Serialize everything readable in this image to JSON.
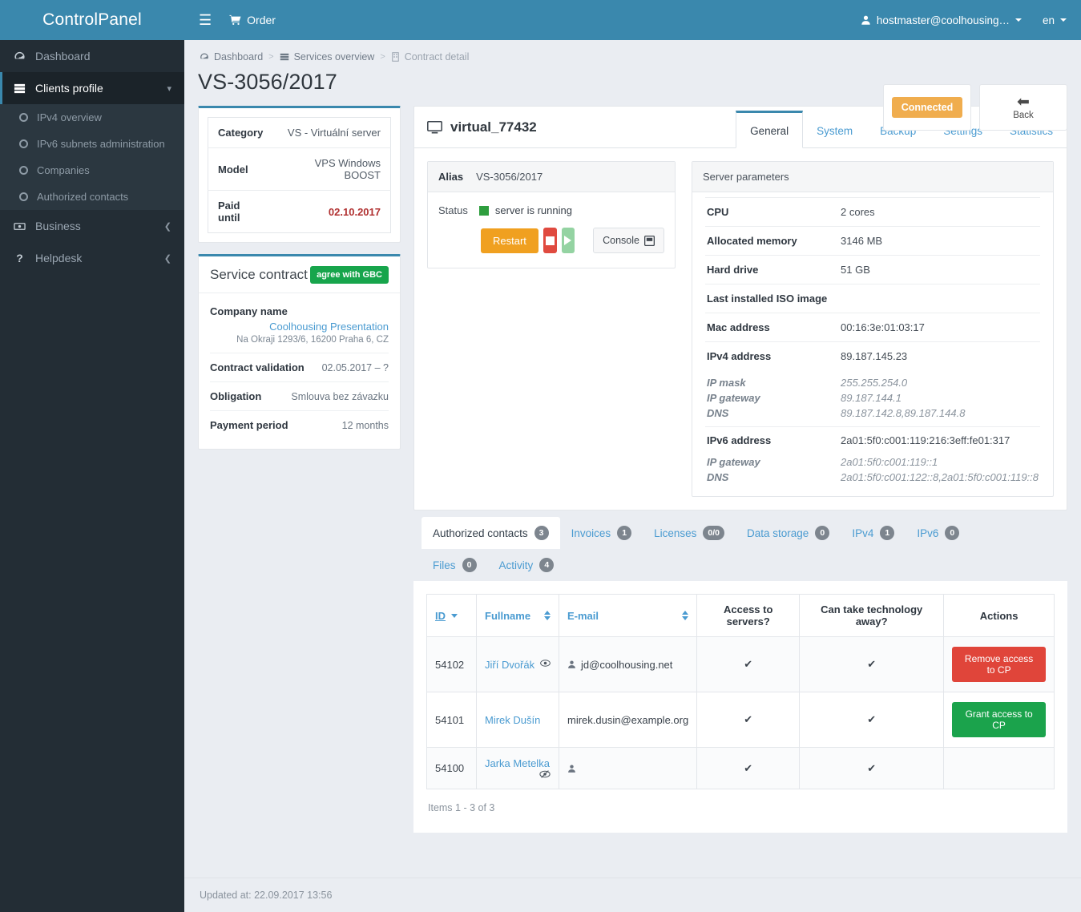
{
  "brand": {
    "title": "ControlPanel"
  },
  "sidebar": {
    "items": [
      {
        "label": "Dashboard",
        "icon": "dashboard-icon",
        "active": false
      },
      {
        "label": "Clients profile",
        "icon": "server-stack-icon",
        "active": true,
        "chevron": "chevron-down-icon"
      },
      {
        "label": "Business",
        "icon": "money-icon",
        "active": false,
        "chevron": "chevron-left-icon"
      },
      {
        "label": "Helpdesk",
        "icon": "question-icon",
        "active": false,
        "chevron": "chevron-left-icon"
      }
    ],
    "subitems": [
      {
        "label": "IPv4 overview"
      },
      {
        "label": "IPv6 subnets administration"
      },
      {
        "label": "Companies"
      },
      {
        "label": "Authorized contacts"
      }
    ]
  },
  "topbar": {
    "menu_icon": "hamburger-icon",
    "order_label": "Order",
    "user_label": "hostmaster@coolhousing…",
    "lang_label": "en"
  },
  "breadcrumb": [
    {
      "label": "Dashboard",
      "icon": "dashboard-icon"
    },
    {
      "label": "Services overview",
      "icon": "server-stack-icon"
    },
    {
      "label": "Contract detail",
      "icon": "building-icon"
    }
  ],
  "page": {
    "title": "VS-3056/2017"
  },
  "head_actions": {
    "connected_label": "Connected",
    "back_label": "Back"
  },
  "summary": {
    "rows": [
      {
        "key": "Category",
        "value": "VS - Virtuální server",
        "red": false
      },
      {
        "key": "Model",
        "value": "VPS Windows BOOST",
        "red": false
      },
      {
        "key": "Paid until",
        "value": "02.10.2017",
        "red": true
      }
    ]
  },
  "service_contract": {
    "title": "Service contract",
    "gbc_badge": "agree with GBC",
    "company_label": "Company name",
    "company_name": "Coolhousing Presentation",
    "company_address": "Na Okraji 1293/6, 16200 Praha 6, CZ",
    "rows": [
      {
        "key": "Contract validation",
        "value": "02.05.2017 – ?"
      },
      {
        "key": "Obligation",
        "value": "Smlouva bez závazku"
      },
      {
        "key": "Payment period",
        "value": "12 months"
      }
    ]
  },
  "server_panel": {
    "name": "virtual_77432",
    "name_icon": "monitor-icon",
    "tabs": [
      {
        "label": "General",
        "active": true
      },
      {
        "label": "System",
        "active": false
      },
      {
        "label": "Backup",
        "active": false
      },
      {
        "label": "Settings",
        "active": false
      },
      {
        "label": "Statistics",
        "active": false
      }
    ],
    "alias_label": "Alias",
    "alias_value": "VS-3056/2017",
    "status_label": "Status",
    "status_value": "server is running",
    "status_color": "#2e9e3e",
    "buttons": {
      "restart": "Restart",
      "stop_icon": "stop-icon",
      "play_icon": "play-icon",
      "console": "Console",
      "console_icon": "terminal-icon"
    },
    "params_title": "Server parameters",
    "params": [
      {
        "key": "CPU",
        "value": "2 cores"
      },
      {
        "key": "Allocated memory",
        "value": "3146 MB"
      },
      {
        "key": "Hard drive",
        "value": "51 GB"
      },
      {
        "key": "Last installed ISO image",
        "value": ""
      },
      {
        "key": "Mac address",
        "value": "00:16:3e:01:03:17"
      },
      {
        "key": "IPv4 address",
        "value": "89.187.145.23"
      }
    ],
    "ipv4_sub": [
      {
        "key": "IP mask",
        "value": "255.255.254.0"
      },
      {
        "key": "IP gateway",
        "value": "89.187.144.1"
      },
      {
        "key": "DNS",
        "value": "89.187.142.8,89.187.144.8"
      }
    ],
    "ipv6": {
      "key": "IPv6 address",
      "value": "2a01:5f0:c001:119:216:3eff:fe01:317"
    },
    "ipv6_sub": [
      {
        "key": "IP gateway",
        "value": "2a01:5f0:c001:119::1"
      },
      {
        "key": "DNS",
        "value": "2a01:5f0:c001:122::8,2a01:5f0:c001:119::8"
      }
    ]
  },
  "bottom_tabs": [
    {
      "label": "Authorized contacts",
      "count": "3",
      "active": true
    },
    {
      "label": "Invoices",
      "count": "1",
      "active": false
    },
    {
      "label": "Licenses",
      "count": "0/0",
      "active": false
    },
    {
      "label": "Data storage",
      "count": "0",
      "active": false
    },
    {
      "label": "IPv4",
      "count": "1",
      "active": false
    },
    {
      "label": "IPv6",
      "count": "0",
      "active": false
    },
    {
      "label": "Files",
      "count": "0",
      "active": false
    },
    {
      "label": "Activity",
      "count": "4",
      "active": false
    }
  ],
  "contacts_table": {
    "headers": {
      "id": "ID",
      "fullname": "Fullname",
      "email": "E-mail",
      "access": "Access to servers?",
      "access_l1": "Access to",
      "access_l2": "servers?",
      "tech_l1": "Can take technology",
      "tech_l2": "away?",
      "actions": "Actions"
    },
    "rows": [
      {
        "id": "54102",
        "fullname": "Jiří Dvořák",
        "vis_icon": "eye-icon",
        "email": "jd@coolhousing.net",
        "email_icon": "user-icon",
        "access": "✔",
        "tech": "✔",
        "action_label": "Remove access to CP",
        "action_type": "remove"
      },
      {
        "id": "54101",
        "fullname": "Mirek Dušín",
        "vis_icon": "",
        "email": "mirek.dusin@example.org",
        "email_icon": "",
        "access": "✔",
        "tech": "✔",
        "action_label": "Grant access to CP",
        "action_type": "grant"
      },
      {
        "id": "54100",
        "fullname": "Jarka Metelka",
        "vis_icon": "eye-slash-icon",
        "email": "",
        "email_icon": "user-icon",
        "access": "✔",
        "tech": "✔",
        "action_label": "",
        "action_type": "none"
      }
    ],
    "items_note": "Items 1 - 3 of 3"
  },
  "footer": {
    "updated": "Updated at: 22.09.2017 13:56"
  },
  "colors": {
    "brand_blue": "#3a88ad",
    "sidebar_dark": "#232d35",
    "link_blue": "#4a9bd1",
    "orange": "#f0a020",
    "green": "#1ba34c",
    "red": "#e0453a",
    "warning": "#f0ad4e",
    "page_bg": "#eaedf2"
  }
}
